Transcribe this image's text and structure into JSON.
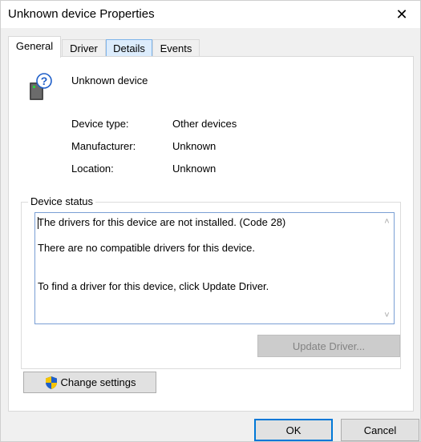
{
  "window": {
    "title": "Unknown device Properties",
    "close_glyph": "✕"
  },
  "tabs": [
    {
      "label": "General",
      "active": true
    },
    {
      "label": "Driver",
      "active": false
    },
    {
      "label": "Details",
      "active": false
    },
    {
      "label": "Events",
      "active": false
    }
  ],
  "device": {
    "name": "Unknown device",
    "icon": "unknown-device-icon",
    "properties": [
      {
        "label": "Device type:",
        "value": "Other devices"
      },
      {
        "label": "Manufacturer:",
        "value": "Unknown"
      },
      {
        "label": "Location:",
        "value": "Unknown"
      }
    ]
  },
  "status": {
    "legend": "Device status",
    "lines": [
      "The drivers for this device are not installed. (Code 28)",
      "There are no compatible drivers for this device.",
      "To find a driver for this device, click Update Driver."
    ]
  },
  "buttons": {
    "update_driver": "Update Driver...",
    "change_settings": "Change settings",
    "ok": "OK",
    "cancel": "Cancel"
  },
  "colors": {
    "accent": "#0078d7",
    "shield_blue": "#1f5fc9",
    "shield_yellow": "#f5c400"
  }
}
